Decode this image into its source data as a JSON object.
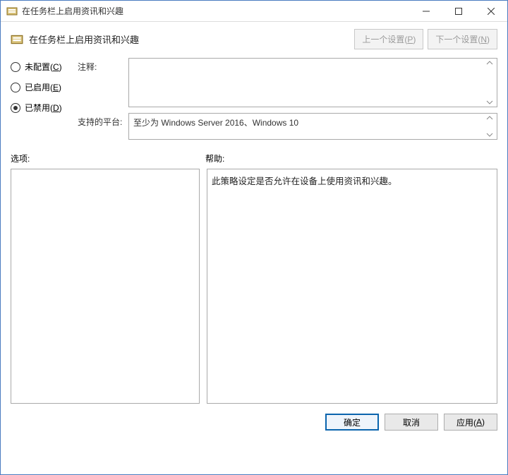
{
  "window": {
    "title": "在任务栏上启用资讯和兴趣"
  },
  "header": {
    "title": "在任务栏上启用资讯和兴趣",
    "prev_btn": "上一个设置(",
    "prev_key": "P",
    "next_btn": "下一个设置(",
    "next_key": "N",
    "close_paren": ")"
  },
  "radios": {
    "not_configured": "未配置(",
    "not_configured_key": "C",
    "enabled": "已启用(",
    "enabled_key": "E",
    "disabled": "已禁用(",
    "disabled_key": "D",
    "close_paren": ")",
    "selected": "disabled"
  },
  "labels": {
    "comment": "注释:",
    "supported": "支持的平台:",
    "options": "选项:",
    "help": "帮助:"
  },
  "fields": {
    "comment": "",
    "supported": "至少为 Windows Server 2016、Windows 10"
  },
  "help_text": "此策略设定是否允许在设备上使用资讯和兴趣。",
  "footer": {
    "ok": "确定",
    "cancel": "取消",
    "apply": "应用(",
    "apply_key": "A",
    "close_paren": ")"
  }
}
